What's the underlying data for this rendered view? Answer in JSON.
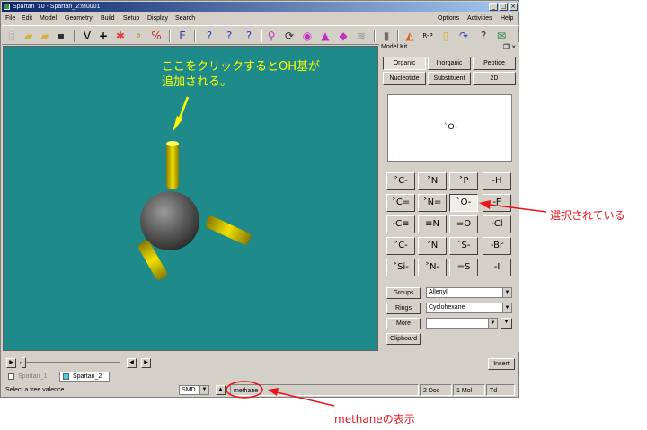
{
  "window": {
    "title": "Spartan '10 - Spartan_2:M0001",
    "controls": [
      "_",
      "□",
      "×"
    ]
  },
  "menu": {
    "left": [
      "File",
      "Edit",
      "Model",
      "Geometry",
      "Build",
      "Setup",
      "Display",
      "Search"
    ],
    "right": [
      "Options",
      "Activities",
      "Help"
    ]
  },
  "viewport": {
    "background": "#1e8a8a",
    "annotation": [
      "ここをクリックするとOH基が",
      "追加される。"
    ]
  },
  "model_kit": {
    "title": "Model Kit",
    "close": "❐ ×",
    "tabs": [
      [
        "Organic",
        "Inorganic",
        "Peptide"
      ],
      [
        "Nucleotide",
        "Substituent",
        "2D"
      ]
    ],
    "active_tab": "Organic",
    "preview_fragment": "`O-",
    "fragments": [
      [
        "˃C-",
        "˃N",
        "˃P",
        "-H"
      ],
      [
        "˃C=",
        "˃N=",
        "`O-",
        "-F"
      ],
      [
        "-C≡",
        "≡N",
        "=O",
        "-Cl"
      ],
      [
        "˃C-",
        "˃N",
        "`S-",
        "-Br"
      ],
      [
        "˃Si-",
        "˃N-",
        "=S",
        "-I"
      ]
    ],
    "selected_fragment": "`O-",
    "groups": {
      "label": "Groups",
      "value": "Allenyl"
    },
    "rings": {
      "label": "Rings",
      "value": "Cyclohexane"
    },
    "more": {
      "label": "More",
      "value": ""
    },
    "clipboard": "Clipboard"
  },
  "playback": {
    "insert": "Insert"
  },
  "doc_tabs": [
    {
      "name": "Spartan_1",
      "color": "#ffffff"
    },
    {
      "name": "Spartan_2",
      "color": "#40d0e0"
    }
  ],
  "status": {
    "message": "Select a free valence.",
    "mode": "SMD",
    "molecule": "methane",
    "docs": "2 Doc",
    "mols": "1 Mol",
    "symmetry": "Td"
  },
  "external": {
    "selected_note": "選択されている",
    "methane_note": "methaneの表示"
  },
  "colors": {
    "annotation_red": "#e8141e",
    "annotation_yellow": "#ffff00",
    "atom_carbon": "#6a6a6a",
    "bond_yellow": "#e8d800"
  }
}
